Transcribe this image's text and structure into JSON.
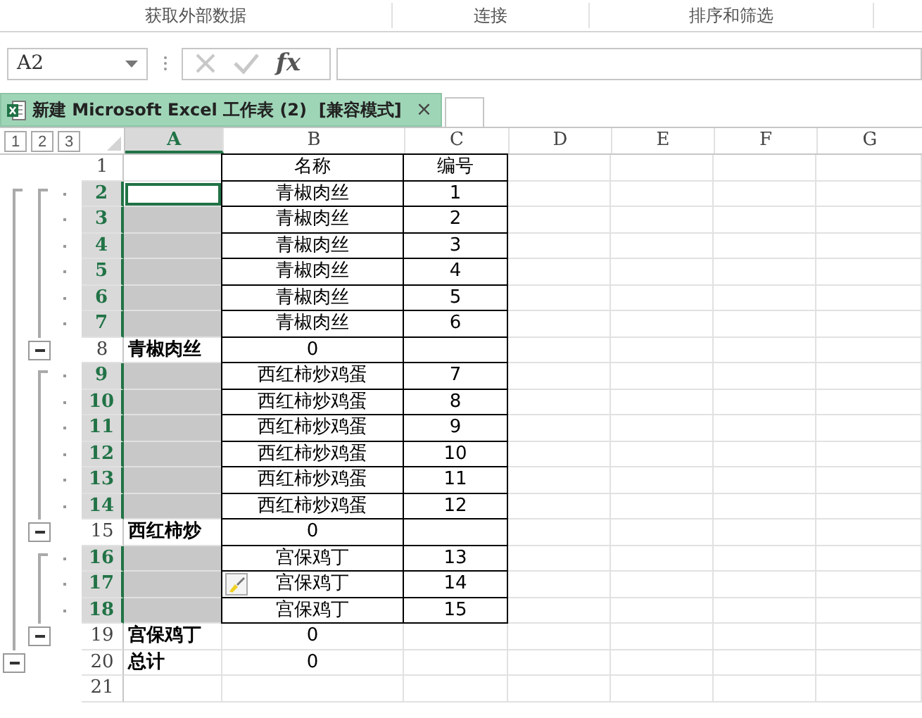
{
  "ribbon_groups": [
    "获取外部数据",
    "连接",
    "排序和筛选"
  ],
  "formula_bar": {
    "name_box": "A2",
    "function_button": "fx"
  },
  "workbook_tab": {
    "title": "新建 Microsoft Excel 工作表 (2)  [兼容模式]",
    "close": "×",
    "selected": true
  },
  "outline_levels": [
    "1",
    "2",
    "3"
  ],
  "columns": [
    {
      "label": "A",
      "selected": true
    },
    {
      "label": "B",
      "selected": false
    },
    {
      "label": "C",
      "selected": false
    },
    {
      "label": "D",
      "selected": false
    },
    {
      "label": "E",
      "selected": false
    },
    {
      "label": "F",
      "selected": false
    },
    {
      "label": "G",
      "selected": false
    }
  ],
  "rows": [
    {
      "number": "1",
      "selected": false,
      "active": false,
      "kind": "plain",
      "bordered": true,
      "paste_options": false,
      "name": "名称",
      "id": "编号"
    },
    {
      "number": "2",
      "selected": true,
      "active": true,
      "kind": "detail",
      "bordered": true,
      "paste_options": false,
      "name": "青椒肉丝",
      "id": "1"
    },
    {
      "number": "3",
      "selected": true,
      "active": false,
      "kind": "detail",
      "bordered": true,
      "paste_options": false,
      "name": "青椒肉丝",
      "id": "2"
    },
    {
      "number": "4",
      "selected": true,
      "active": false,
      "kind": "detail",
      "bordered": true,
      "paste_options": false,
      "name": "青椒肉丝",
      "id": "3"
    },
    {
      "number": "5",
      "selected": true,
      "active": false,
      "kind": "detail",
      "bordered": true,
      "paste_options": false,
      "name": "青椒肉丝",
      "id": "4"
    },
    {
      "number": "6",
      "selected": true,
      "active": false,
      "kind": "detail",
      "bordered": true,
      "paste_options": false,
      "name": "青椒肉丝",
      "id": "5"
    },
    {
      "number": "7",
      "selected": true,
      "active": false,
      "kind": "detail",
      "bordered": true,
      "paste_options": false,
      "name": "青椒肉丝",
      "id": "6"
    },
    {
      "number": "8",
      "selected": false,
      "active": false,
      "kind": "subtotal",
      "bordered": true,
      "paste_options": false,
      "label": "青椒肉丝",
      "name": "0"
    },
    {
      "number": "9",
      "selected": true,
      "active": false,
      "kind": "detail",
      "bordered": true,
      "paste_options": false,
      "name": "西红柿炒鸡蛋",
      "id": "7"
    },
    {
      "number": "10",
      "selected": true,
      "active": false,
      "kind": "detail",
      "bordered": true,
      "paste_options": false,
      "name": "西红柿炒鸡蛋",
      "id": "8"
    },
    {
      "number": "11",
      "selected": true,
      "active": false,
      "kind": "detail",
      "bordered": true,
      "paste_options": false,
      "name": "西红柿炒鸡蛋",
      "id": "9"
    },
    {
      "number": "12",
      "selected": true,
      "active": false,
      "kind": "detail",
      "bordered": true,
      "paste_options": false,
      "name": "西红柿炒鸡蛋",
      "id": "10"
    },
    {
      "number": "13",
      "selected": true,
      "active": false,
      "kind": "detail",
      "bordered": true,
      "paste_options": false,
      "name": "西红柿炒鸡蛋",
      "id": "11"
    },
    {
      "number": "14",
      "selected": true,
      "active": false,
      "kind": "detail",
      "bordered": true,
      "paste_options": false,
      "name": "西红柿炒鸡蛋",
      "id": "12"
    },
    {
      "number": "15",
      "selected": false,
      "active": false,
      "kind": "subtotal",
      "bordered": true,
      "paste_options": false,
      "label": "西红柿炒",
      "name": "0"
    },
    {
      "number": "16",
      "selected": true,
      "active": false,
      "kind": "detail",
      "bordered": true,
      "paste_options": false,
      "name": "宫保鸡丁",
      "id": "13"
    },
    {
      "number": "17",
      "selected": true,
      "active": false,
      "kind": "detail",
      "bordered": true,
      "paste_options": true,
      "name": "宫保鸡丁",
      "id": "14"
    },
    {
      "number": "18",
      "selected": true,
      "active": false,
      "kind": "detail",
      "bordered": true,
      "paste_options": false,
      "name": "宫保鸡丁",
      "id": "15"
    },
    {
      "number": "19",
      "selected": false,
      "active": false,
      "kind": "subtotal",
      "bordered": false,
      "paste_options": false,
      "label": "宫保鸡丁",
      "name": "0"
    },
    {
      "number": "20",
      "selected": false,
      "active": false,
      "kind": "total",
      "bordered": false,
      "paste_options": false,
      "label": "总计",
      "name": "0"
    },
    {
      "number": "21",
      "selected": false,
      "active": false,
      "kind": "plain",
      "bordered": false,
      "paste_options": false
    }
  ]
}
